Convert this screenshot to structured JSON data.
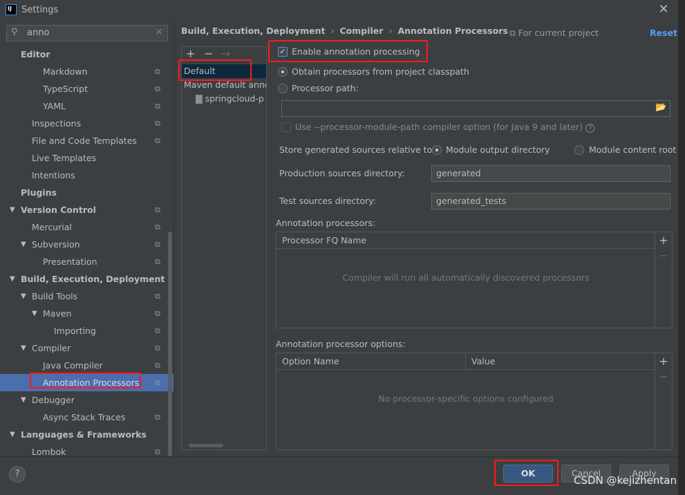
{
  "window": {
    "title": "Settings",
    "logo": "IJ",
    "close_icon": "close-icon"
  },
  "search": {
    "value": "anno"
  },
  "sidebar": {
    "items": [
      {
        "label": "Editor",
        "level": 0,
        "bold": true
      },
      {
        "label": "Markdown",
        "level": 2,
        "copy": true
      },
      {
        "label": "TypeScript",
        "level": 2,
        "copy": true
      },
      {
        "label": "YAML",
        "level": 2,
        "copy": true
      },
      {
        "label": "Inspections",
        "level": 1,
        "copy": true
      },
      {
        "label": "File and Code Templates",
        "level": 1,
        "copy": true
      },
      {
        "label": "Live Templates",
        "level": 1
      },
      {
        "label": "Intentions",
        "level": 1
      },
      {
        "label": "Plugins",
        "level": 0,
        "bold": true
      },
      {
        "label": "Version Control",
        "level": 0,
        "bold": true,
        "expanded": true,
        "copy": true
      },
      {
        "label": "Mercurial",
        "level": 1,
        "copy": true
      },
      {
        "label": "Subversion",
        "level": 1,
        "expanded": true,
        "copy": true
      },
      {
        "label": "Presentation",
        "level": 2,
        "copy": true
      },
      {
        "label": "Build, Execution, Deployment",
        "level": 0,
        "bold": true,
        "expanded": true
      },
      {
        "label": "Build Tools",
        "level": 1,
        "expanded": true,
        "copy": true
      },
      {
        "label": "Maven",
        "level": 2,
        "expanded": true,
        "copy": true
      },
      {
        "label": "Importing",
        "level": 3,
        "copy": true
      },
      {
        "label": "Compiler",
        "level": 1,
        "expanded": true,
        "copy": true
      },
      {
        "label": "Java Compiler",
        "level": 2,
        "copy": true
      },
      {
        "label": "Annotation Processors",
        "level": 2,
        "copy": true,
        "selected": true
      },
      {
        "label": "Debugger",
        "level": 1,
        "expanded": true
      },
      {
        "label": "Async Stack Traces",
        "level": 2,
        "copy": true
      },
      {
        "label": "Languages & Frameworks",
        "level": 0,
        "bold": true,
        "expanded": true
      },
      {
        "label": "Lombok",
        "level": 1,
        "copy": true
      }
    ]
  },
  "breadcrumb": [
    "Build, Execution, Deployment",
    "Compiler",
    "Annotation Processors"
  ],
  "for_current_project": "For current project",
  "reset": "Reset",
  "profiles": {
    "toolbar": [
      "+",
      "−",
      "→"
    ],
    "items": [
      {
        "label": "Default",
        "selected": true
      },
      {
        "label": "Maven default annotation processors profile"
      },
      {
        "label": "springcloud-p",
        "child": true
      }
    ]
  },
  "form": {
    "enable": {
      "label": "Enable annotation processing",
      "checked": true
    },
    "obtain": {
      "label": "Obtain processors from project classpath",
      "selected": true
    },
    "path": {
      "label": "Processor path:",
      "value": ""
    },
    "module_path": {
      "label": "Use --processor-module-path compiler option (for Java 9 and later)",
      "checked": false
    },
    "store_label": "Store generated sources relative to:",
    "store_options": [
      {
        "label": "Module output directory",
        "selected": true
      },
      {
        "label": "Module content root",
        "selected": false
      }
    ],
    "prod_label": "Production sources directory:",
    "prod_value": "generated",
    "test_label": "Test sources directory:",
    "test_value": "generated_tests",
    "processors_label": "Annotation processors:",
    "processors_col": "Processor FQ Name",
    "processors_empty": "Compiler will run all automatically discovered processors",
    "options_label": "Annotation processor options:",
    "options_cols": [
      "Option Name",
      "Value"
    ],
    "options_empty": "No processor-specific options configured"
  },
  "buttons": {
    "ok": "OK",
    "cancel": "Cancel",
    "apply": "Apply",
    "help": "?"
  },
  "watermark": "CSDN @kejizhentan",
  "colors": {
    "selection": "#4b6eaf",
    "highlight": "#ff1a1a",
    "link": "#589df6"
  }
}
